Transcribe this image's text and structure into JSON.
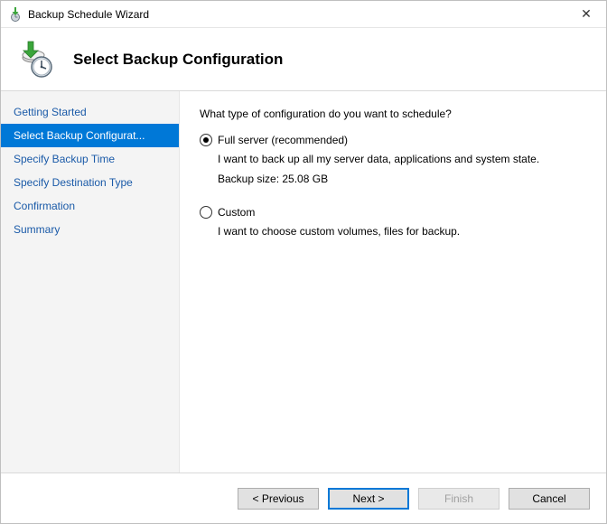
{
  "window": {
    "title": "Backup Schedule Wizard",
    "close_glyph": "✕"
  },
  "header": {
    "title": "Select Backup Configuration"
  },
  "sidebar": {
    "steps": [
      {
        "label": "Getting Started"
      },
      {
        "label": "Select Backup Configurat..."
      },
      {
        "label": "Specify Backup Time"
      },
      {
        "label": "Specify Destination Type"
      },
      {
        "label": "Confirmation"
      },
      {
        "label": "Summary"
      }
    ],
    "active_index": 1
  },
  "content": {
    "question": "What type of configuration do you want to schedule?",
    "options": [
      {
        "label": "Full server (recommended)",
        "description": "I want to back up all my server data, applications and system state.",
        "size_line": "Backup size: 25.08 GB",
        "selected": true
      },
      {
        "label": "Custom",
        "description": "I want to choose custom volumes, files for backup.",
        "size_line": null,
        "selected": false
      }
    ]
  },
  "footer": {
    "previous": "< Previous",
    "next": "Next >",
    "finish": "Finish",
    "cancel": "Cancel"
  }
}
